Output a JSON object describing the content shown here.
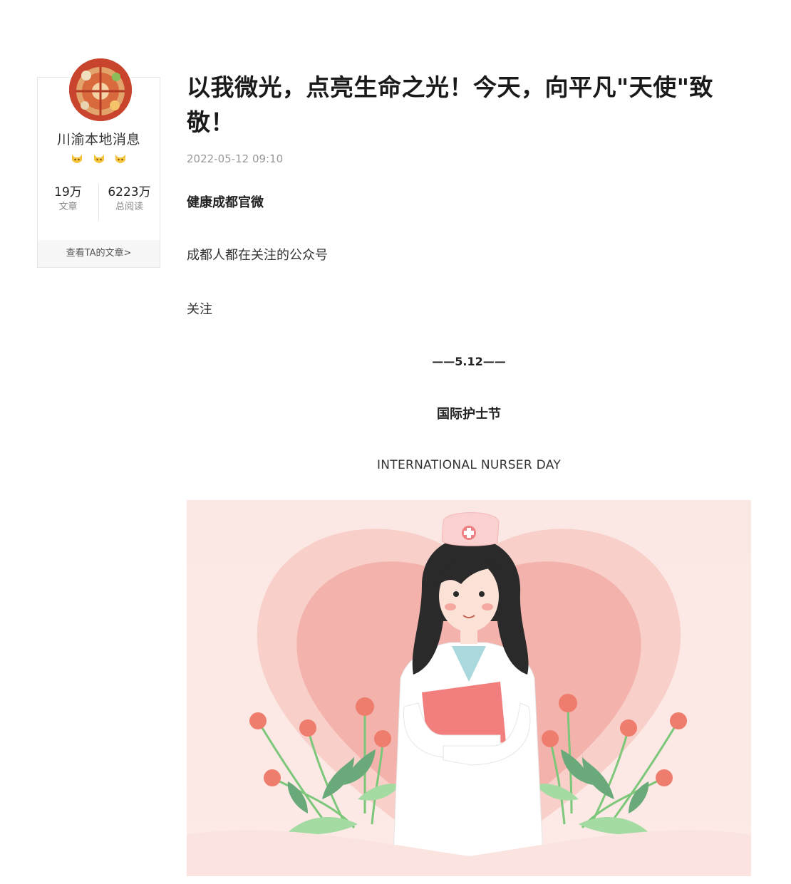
{
  "author": {
    "name": "川渝本地消息",
    "stats": [
      {
        "value": "19万",
        "label": "文章"
      },
      {
        "value": "6223万",
        "label": "总阅读"
      }
    ],
    "link_label": "查看TA的文章>"
  },
  "article": {
    "title": "以我微光，点亮生命之光！今天，向平凡\"天使\"致敬！",
    "date": "2022-05-12 09:10",
    "source": "健康成都官微",
    "paragraphs": [
      "成都人都在关注的公众号",
      "关注"
    ],
    "center_lines": [
      "——5.12——",
      "国际护士节",
      "INTERNATIONAL NURSER DAY"
    ]
  },
  "colors": {
    "heart": "#f4b7b3",
    "nurse_coat": "#ffffff",
    "folder": "#f37e7e",
    "leaf": "#8fcf8e",
    "flower": "#ef7d6e"
  }
}
